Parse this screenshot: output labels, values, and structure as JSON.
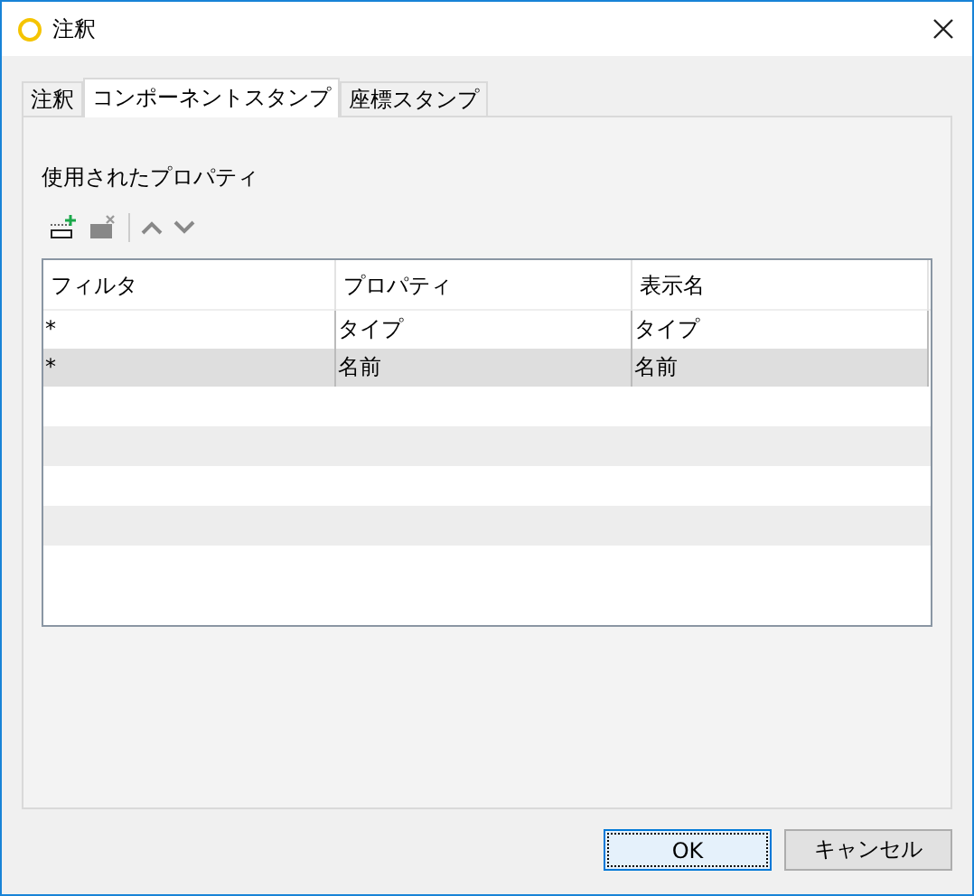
{
  "window": {
    "title": "注釈"
  },
  "tabs": [
    {
      "label": "注釈",
      "selected": false
    },
    {
      "label": "コンポーネントスタンプ",
      "selected": true
    },
    {
      "label": "座標スタンプ",
      "selected": false
    }
  ],
  "section_label": "使用されたプロパティ",
  "table": {
    "columns": [
      "フィルタ",
      "プロパティ",
      "表示名"
    ],
    "rows": [
      [
        "*",
        "タイプ",
        "タイプ"
      ],
      [
        "*",
        "名前",
        "名前"
      ]
    ]
  },
  "buttons": [
    {
      "label": "OK",
      "default": true
    },
    {
      "label": "キャンセル",
      "default": false
    }
  ]
}
